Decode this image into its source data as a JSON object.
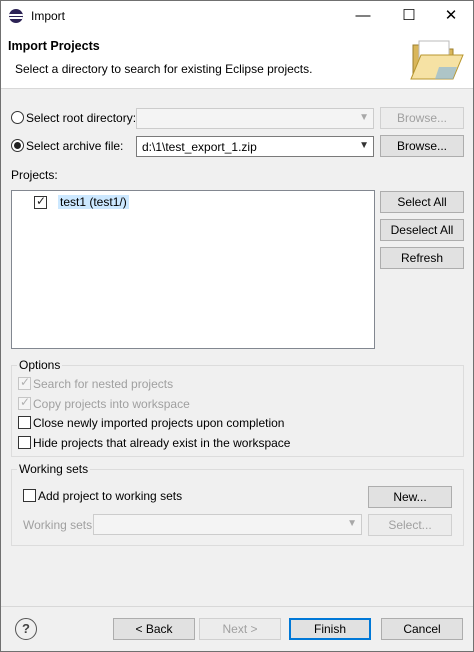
{
  "window": {
    "title": "Import",
    "minimize": "—",
    "maximize": "☐",
    "close": "✕"
  },
  "header": {
    "title": "Import Projects",
    "description": "Select a directory to search for existing Eclipse projects."
  },
  "root_directory": {
    "label": "Select root directory:",
    "value": "",
    "browse_label": "Browse...",
    "selected": false
  },
  "archive_file": {
    "label": "Select archive file:",
    "value": "d:\\1\\test_export_1.zip",
    "browse_label": "Browse...",
    "selected": true
  },
  "projects": {
    "label": "Projects:",
    "items": [
      {
        "label": "test1 (test1/)",
        "checked": true
      }
    ],
    "select_all_label": "Select All",
    "deselect_all_label": "Deselect All",
    "refresh_label": "Refresh"
  },
  "options": {
    "legend": "Options",
    "search_nested": "Search for nested projects",
    "copy_projects": "Copy projects into workspace",
    "close_imported": "Close newly imported projects upon completion",
    "hide_existing": "Hide projects that already exist in the workspace"
  },
  "working_sets": {
    "legend": "Working sets",
    "add_label": "Add project to working sets",
    "new_label": "New...",
    "sets_label": "Working sets:",
    "sets_value": "",
    "select_label": "Select..."
  },
  "footer": {
    "help": "?",
    "back_label": "< Back",
    "next_label": "Next >",
    "finish_label": "Finish",
    "cancel_label": "Cancel"
  }
}
